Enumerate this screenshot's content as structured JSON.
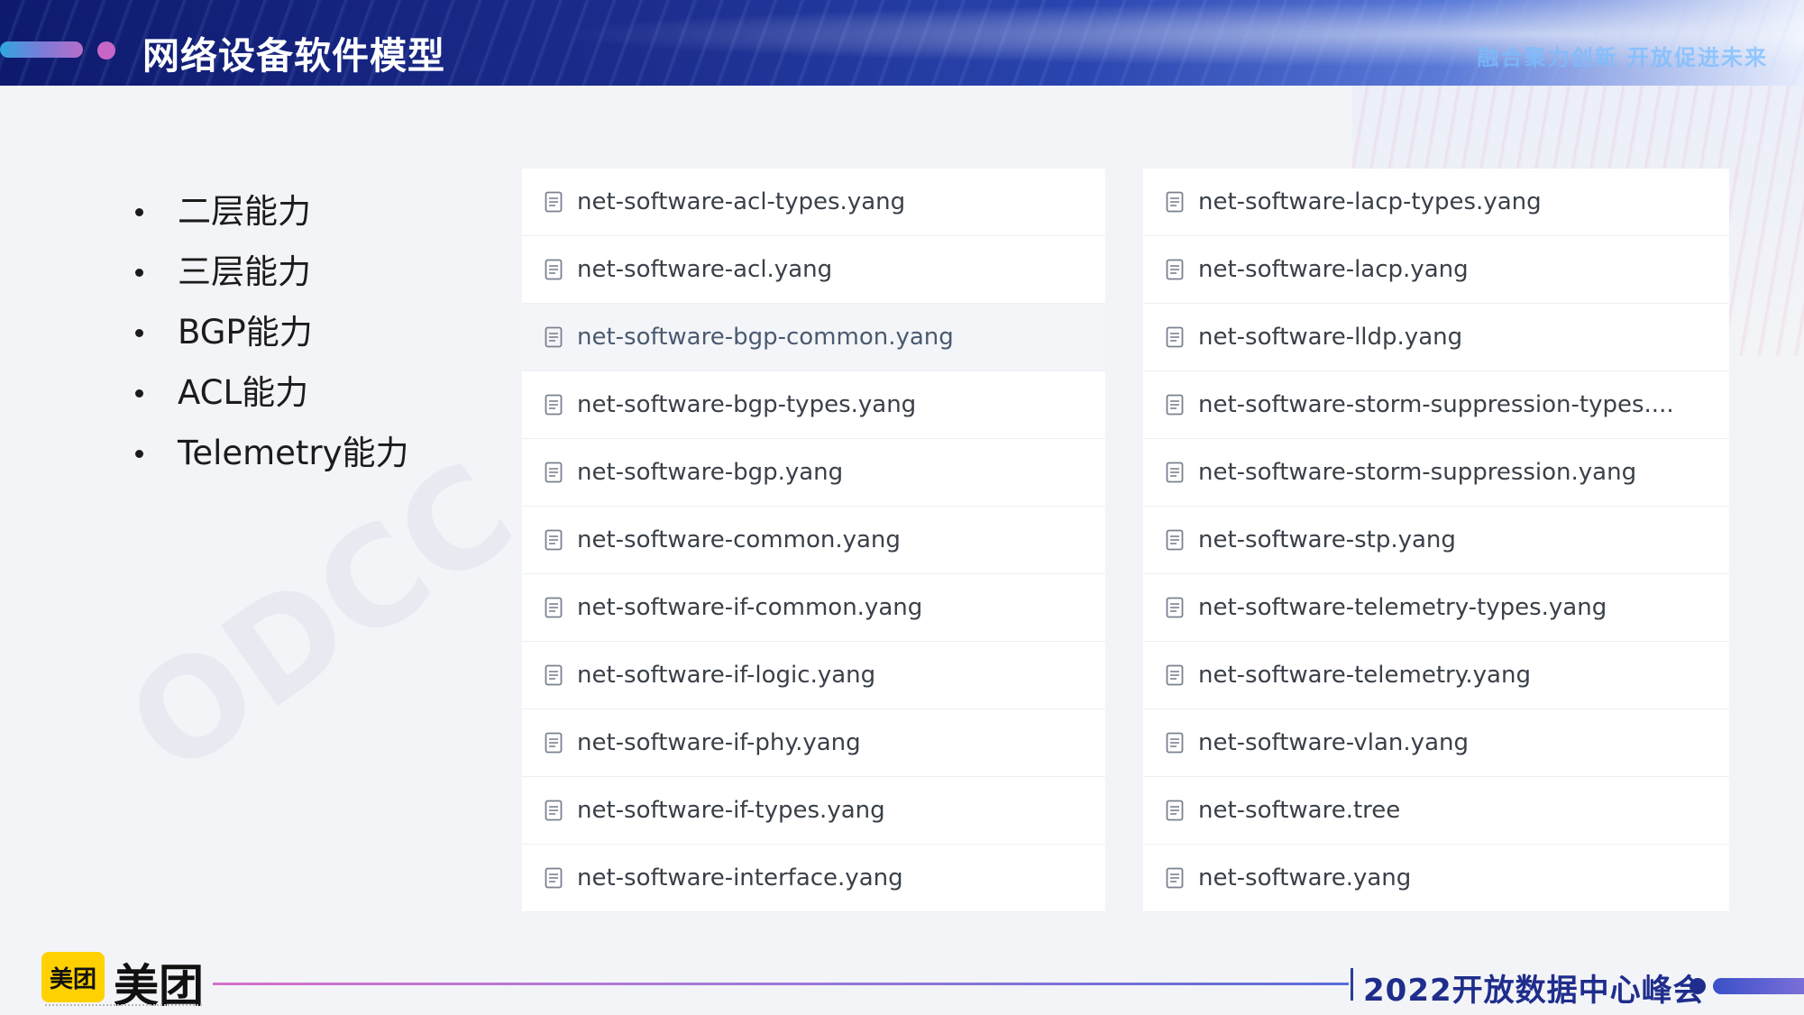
{
  "header": {
    "title": "网络设备软件模型",
    "slogan": "融合聚力创新  开放促进未来"
  },
  "capabilities": [
    "二层能力",
    "三层能力",
    "BGP能力",
    "ACL能力",
    "Telemetry能力"
  ],
  "files_left": [
    "net-software-acl-types.yang",
    "net-software-acl.yang",
    "net-software-bgp-common.yang",
    "net-software-bgp-types.yang",
    "net-software-bgp.yang",
    "net-software-common.yang",
    "net-software-if-common.yang",
    "net-software-if-logic.yang",
    "net-software-if-phy.yang",
    "net-software-if-types.yang",
    "net-software-interface.yang"
  ],
  "files_right": [
    "net-software-lacp-types.yang",
    "net-software-lacp.yang",
    "net-software-lldp.yang",
    "net-software-storm-suppression-types....",
    "net-software-storm-suppression.yang",
    "net-software-stp.yang",
    "net-software-telemetry-types.yang",
    "net-software-telemetry.yang",
    "net-software-vlan.yang",
    "net-software.tree",
    "net-software.yang"
  ],
  "highlighted_left_index": 2,
  "icons": {
    "file": "file-icon"
  },
  "footer": {
    "logo_mark": "美团",
    "logo_text": "美团",
    "event": "2022开放数据中心峰会",
    "watermark": "ODCC"
  },
  "colors": {
    "header_dark": "#0e1a6e",
    "accent_pink": "#c866c8",
    "footer_blue": "#1f2d8c",
    "meituan_yellow": "#ffd100"
  }
}
